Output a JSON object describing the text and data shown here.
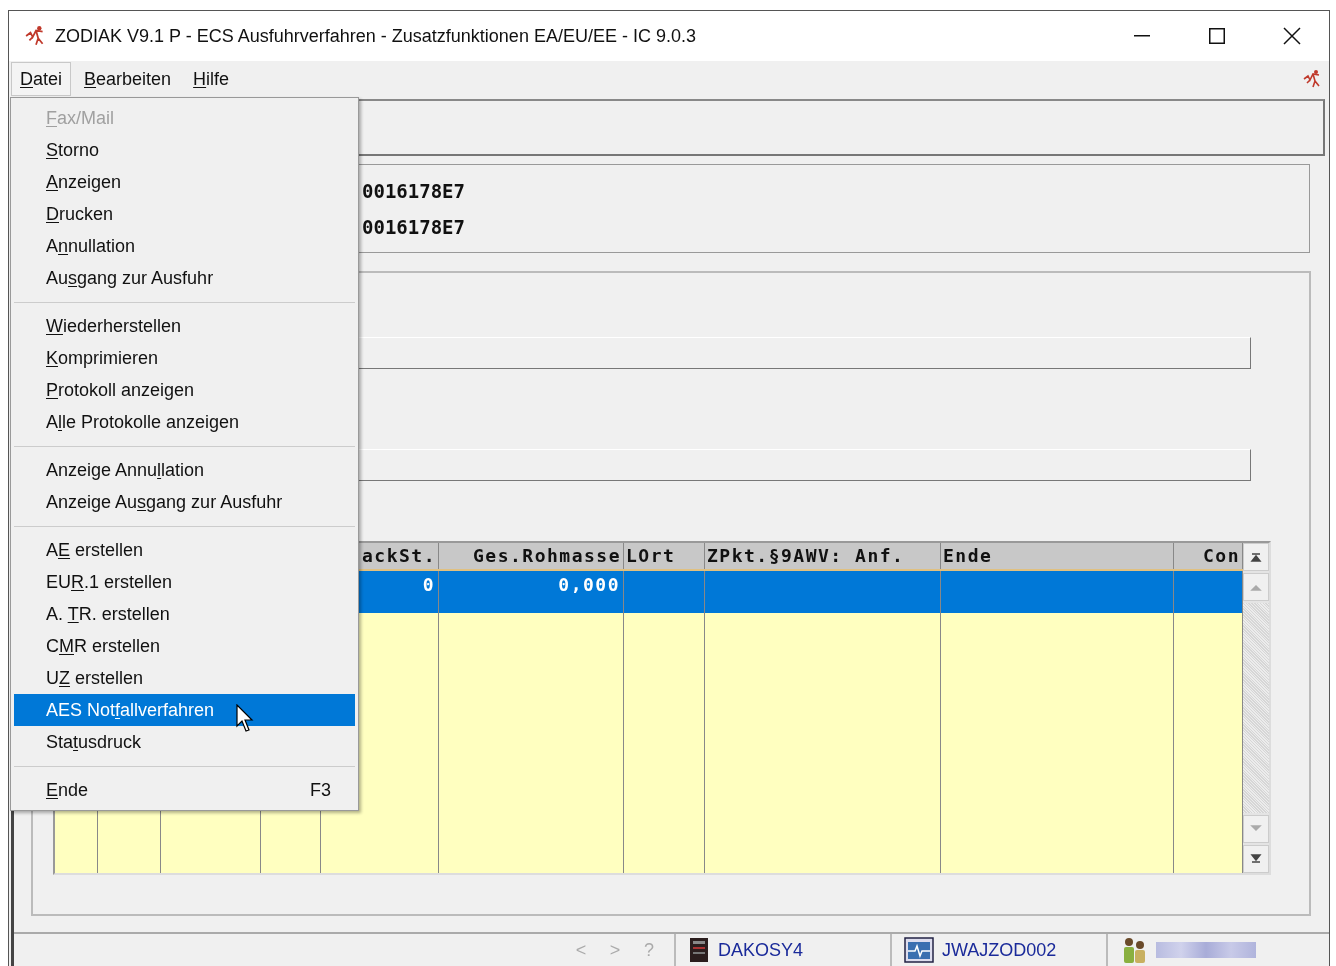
{
  "window": {
    "title": "ZODIAK V9.1 P - ECS Ausfuhrverfahren - Zusatzfunktionen EA/EU/EE - IC 9.0.3"
  },
  "menubar": [
    {
      "key": "D",
      "after": "atei",
      "selected": true
    },
    {
      "key": "B",
      "after": "earbeiten",
      "selected": false
    },
    {
      "key": "H",
      "after": "ilfe",
      "selected": false
    }
  ],
  "file_menu": {
    "items": [
      {
        "kind": "item",
        "key": "F",
        "after": "ax/Mail",
        "disabled": true,
        "selected": false
      },
      {
        "kind": "item",
        "key": "S",
        "after": "torno",
        "disabled": false,
        "selected": false
      },
      {
        "kind": "item",
        "key": "A",
        "after": "nzeigen",
        "disabled": false,
        "selected": false
      },
      {
        "kind": "item",
        "key": "D",
        "after": "rucken",
        "disabled": false,
        "selected": false
      },
      {
        "kind": "item",
        "before": "A",
        "key": "n",
        "after": "nullation",
        "disabled": false,
        "selected": false
      },
      {
        "kind": "item",
        "before": "Au",
        "key": "s",
        "after": "gang zur Ausfuhr",
        "disabled": false,
        "selected": false
      },
      {
        "kind": "separator"
      },
      {
        "kind": "item",
        "key": "W",
        "after": "iederherstellen",
        "disabled": false,
        "selected": false
      },
      {
        "kind": "item",
        "key": "K",
        "after": "omprimieren",
        "disabled": false,
        "selected": false
      },
      {
        "kind": "item",
        "key": "P",
        "after": "rotokoll anzeigen",
        "disabled": false,
        "selected": false
      },
      {
        "kind": "item",
        "before": "A",
        "key": "l",
        "after": "le Protokolle anzeigen",
        "disabled": false,
        "selected": false
      },
      {
        "kind": "separator"
      },
      {
        "kind": "item",
        "before": "Anzeige Annu",
        "key": "l",
        "after": "lation",
        "disabled": false,
        "selected": false
      },
      {
        "kind": "item",
        "before": "Anzeige Au",
        "key": "s",
        "after": "gang zur Ausfuhr",
        "disabled": false,
        "selected": false
      },
      {
        "kind": "separator"
      },
      {
        "kind": "item",
        "before": "A",
        "key": "E",
        "after": " erstellen",
        "disabled": false,
        "selected": false
      },
      {
        "kind": "item",
        "before": "EU",
        "key": "R",
        "after": ".1 erstellen",
        "disabled": false,
        "selected": false
      },
      {
        "kind": "item",
        "before": "A. ",
        "key": "T",
        "after": "R. erstellen",
        "disabled": false,
        "selected": false
      },
      {
        "kind": "item",
        "before": "C",
        "key": "M",
        "after": "R erstellen",
        "disabled": false,
        "selected": false
      },
      {
        "kind": "item",
        "before": "U",
        "key": "Z",
        "after": " erstellen",
        "disabled": false,
        "selected": false
      },
      {
        "kind": "item",
        "before": "AES Not",
        "key": "f",
        "after": "allverfahren",
        "disabled": false,
        "selected": true
      },
      {
        "kind": "item",
        "before": "Sta",
        "key": "t",
        "after": "usdruck",
        "disabled": false,
        "selected": false
      },
      {
        "kind": "separator"
      },
      {
        "kind": "item",
        "key": "E",
        "after": "nde",
        "shortcut": "F3",
        "disabled": false,
        "selected": false
      }
    ]
  },
  "id_panel": {
    "lines": [
      "0016178E7",
      "0016178E7"
    ]
  },
  "table": {
    "columns": [
      {
        "header": "ackSt."
      },
      {
        "header": "Ges.Rohmasse"
      },
      {
        "header": "LOrt"
      },
      {
        "header": "ZPkt.§9AWV: Anf."
      },
      {
        "header": "Ende"
      },
      {
        "header": "Con"
      }
    ],
    "rows": [
      {
        "selected": true,
        "cells": [
          "0",
          "0,000"
        ]
      }
    ]
  },
  "status_bar": {
    "nav": [
      {
        "label": "<",
        "disabled": true
      },
      {
        "label": ">",
        "disabled": true
      },
      {
        "label": "?",
        "disabled": true
      }
    ],
    "items": [
      {
        "kind": "server",
        "text": "DAKOSY4"
      },
      {
        "kind": "module",
        "text": "JWAJZOD002"
      },
      {
        "kind": "user"
      }
    ]
  }
}
